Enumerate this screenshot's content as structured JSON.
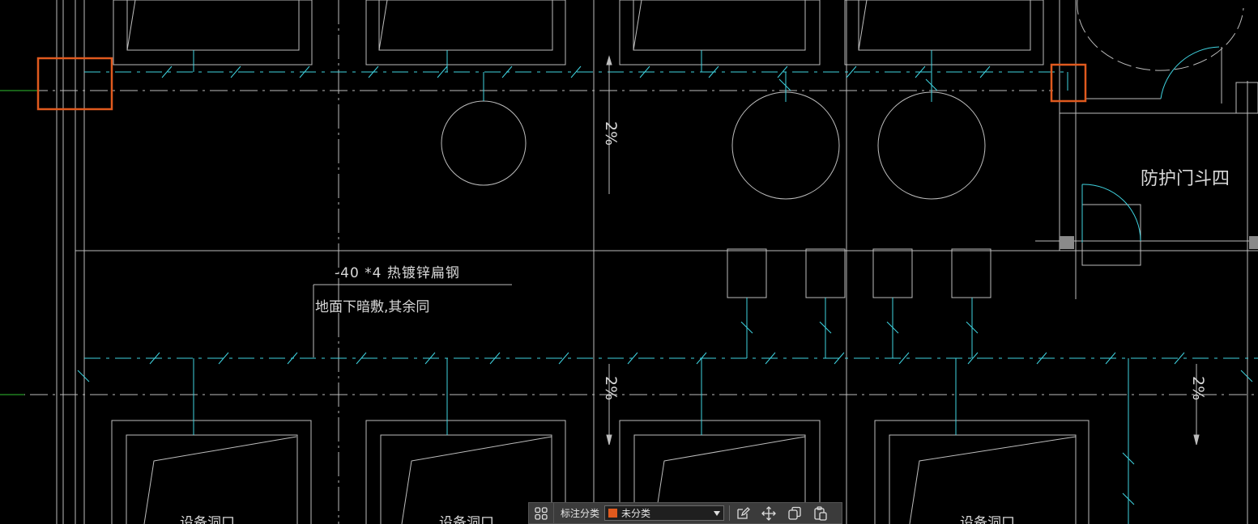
{
  "drawing": {
    "labels": {
      "steel": "-40 *4 热镀锌扁钢",
      "note": "地面下暗敷,其余同",
      "room": "防护门斗四",
      "slope": "2%",
      "pit": "设备洞口"
    }
  },
  "toolbar": {
    "category_label": "标注分类",
    "category_value": "未分类",
    "swatch_color": "#e05a1e",
    "icons": [
      "grid-icon",
      "edit-icon",
      "move-icon",
      "copy-icon",
      "paste-icon"
    ]
  },
  "colors": {
    "background": "#000000",
    "grounding": "#3fd3e0",
    "walls": "#c8c8c8",
    "highlight": "#e05a1e"
  }
}
